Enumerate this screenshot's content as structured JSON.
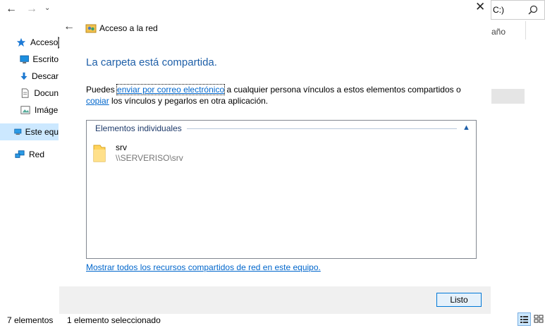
{
  "explorer": {
    "back_icon": "back-arrow-icon",
    "forward_icon": "forward-arrow-icon",
    "recent_icon": "chevron-down-icon",
    "search_fragment": "C:)",
    "column_fragment": "año",
    "sidebar": [
      {
        "label": "Acceso",
        "icon": "star-icon"
      },
      {
        "label": "Escrito",
        "icon": "desktop-icon"
      },
      {
        "label": "Descar",
        "icon": "download-icon"
      },
      {
        "label": "Docun",
        "icon": "document-icon"
      },
      {
        "label": "Imáge",
        "icon": "picture-icon"
      },
      {
        "label": "Este equ",
        "icon": "computer-icon"
      },
      {
        "label": "Red",
        "icon": "network-icon"
      }
    ],
    "status_count": "7 elementos",
    "status_selected": "1 elemento seleccionado"
  },
  "dialog": {
    "title": "Acceso a la red",
    "heading": "La carpeta está compartida.",
    "desc_prefix": "Puedes ",
    "email_link": "enviar por correo electrónico",
    "desc_middle": " a cualquier persona vínculos a estos elementos compartidos o",
    "copy_link": "copiar",
    "desc_suffix": " los vínculos y pegarlos en otra aplicación.",
    "group_title": "Elementos individuales",
    "items": [
      {
        "name": "srv",
        "path": "\\\\SERVERISO\\srv"
      }
    ],
    "show_all_link": "Mostrar todos los recursos compartidos de red en este equipo.",
    "done_button": "Listo"
  },
  "colors": {
    "heading": "#1e5fa8",
    "link": "#0066cc",
    "accent": "#0078d7"
  }
}
